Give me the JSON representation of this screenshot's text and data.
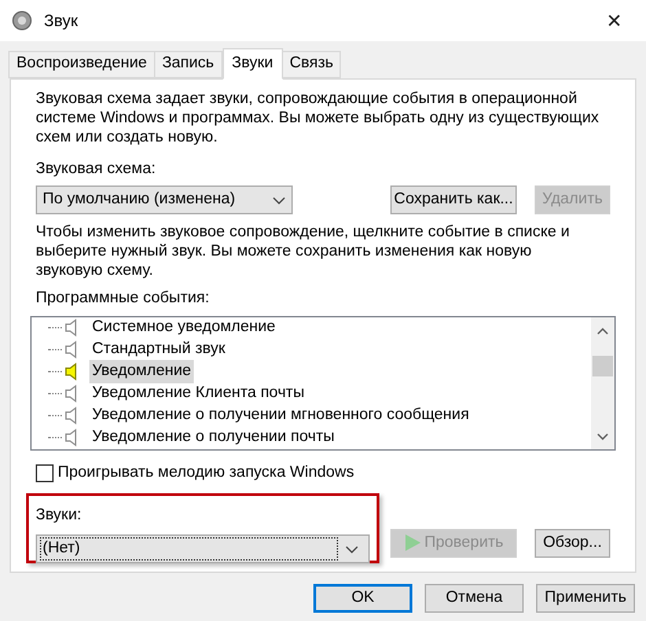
{
  "window": {
    "title": "Звук",
    "close": "✕"
  },
  "tabs": [
    {
      "label": "Воспроизведение",
      "selected": false
    },
    {
      "label": "Запись",
      "selected": false
    },
    {
      "label": "Звуки",
      "selected": true
    },
    {
      "label": "Связь",
      "selected": false
    }
  ],
  "intro": "Звуковая схема задает звуки, сопровождающие события в операционной системе Windows и программах. Вы можете выбрать одну из существующих схем или создать новую.",
  "scheme": {
    "label": "Звуковая схема:",
    "value": "По умолчанию (изменена)",
    "buttons": [
      {
        "label": "Сохранить как...",
        "disabled": false
      },
      {
        "label": "Удалить",
        "disabled": true
      }
    ]
  },
  "hint": "Чтобы изменить звуковое сопровождение, щелкните событие в списке и выберите нужный звук. Вы можете сохранить изменения как новую звуковую схему.",
  "events": {
    "label": "Программные события:",
    "items": [
      {
        "label": "Системное уведомление",
        "selected": false,
        "has_sound": false
      },
      {
        "label": "Стандартный звук",
        "selected": false,
        "has_sound": false
      },
      {
        "label": "Уведомление",
        "selected": true,
        "has_sound": true
      },
      {
        "label": "Уведомление Клиента почты",
        "selected": false,
        "has_sound": false
      },
      {
        "label": "Уведомление о получении мгновенного сообщения",
        "selected": false,
        "has_sound": false
      },
      {
        "label": "Уведомление о получении почты",
        "selected": false,
        "has_sound": false
      }
    ]
  },
  "startup": {
    "label": "Проигрывать мелодию запуска Windows",
    "checked": false
  },
  "sounds": {
    "label": "Звуки:",
    "value": "(Нет)",
    "buttons": [
      {
        "kind": "play",
        "label": "Проверить",
        "disabled": true
      },
      {
        "kind": "plain",
        "label": "Обзор...",
        "disabled": false
      }
    ]
  },
  "dialog_buttons": [
    {
      "label": "OK",
      "default": true
    },
    {
      "label": "Отмена",
      "default": false
    },
    {
      "label": "Применить",
      "default": false
    }
  ]
}
